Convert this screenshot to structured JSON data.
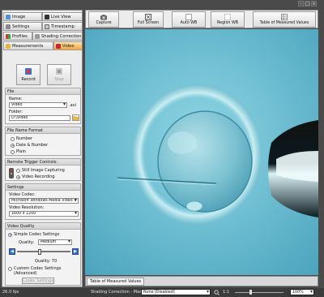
{
  "tabs": {
    "row1": [
      "Image",
      "Live View"
    ],
    "row2": [
      "Settings",
      "Timestamp"
    ],
    "row3": [
      "Profiles",
      "Shading Correction"
    ],
    "row4": [
      "Measurements",
      "Video"
    ]
  },
  "record": {
    "record_label": "Record",
    "stop_label": "Stop"
  },
  "file": {
    "title": "File",
    "name_label": "Name:",
    "name_value": "Video",
    "ext": ".avi",
    "folder_label": "Folder:",
    "folder_value": "D:\\Video"
  },
  "format": {
    "title": "File Name Format",
    "options": [
      "Number",
      "Date & Number",
      "Plain"
    ],
    "selected": "Date & Number"
  },
  "trigger": {
    "title": "Remote Trigger Controls:",
    "options": [
      "Still Image Capturing",
      "Video Recording"
    ],
    "selected": "Video Recording"
  },
  "settings": {
    "title": "Settings",
    "codec_label": "Video Codec:",
    "codec_value": "Microsoft Windows Media Video 9",
    "res_label": "Video Resolution:",
    "res_value": "1600 x 1200"
  },
  "quality": {
    "title": "Video Quality",
    "simple_label": "Simple Codec Settings",
    "quality_label": "Quality:",
    "quality_value": "Medium",
    "quality_number_text": "Quality: 70",
    "quality_level": 70,
    "custom_label": "Custom Codec Settings (Advanced)",
    "codec_btn": "Codec Settings"
  },
  "toolbar": {
    "buttons": [
      "Capture",
      "Full Screen",
      "Auto WB",
      "Region WB",
      "Table of Measured Values"
    ]
  },
  "bottom": {
    "tab_label": "Table of Measured Values"
  },
  "status": {
    "fps": "26.0 fps",
    "shading": "Shading Correction - Mask:",
    "mask_value": "None [Disabled]",
    "ratio": "1:1",
    "zoom": "100%"
  },
  "colors": {
    "accent": "#f5a53a",
    "view_bg": "#6ec3d6"
  }
}
